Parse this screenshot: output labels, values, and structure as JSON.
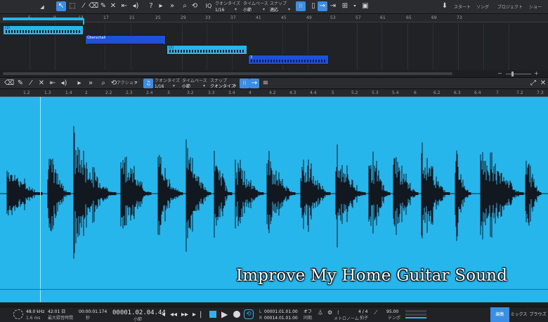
{
  "toolbar": {
    "quantize_label": "クオンタイズ",
    "quantize_value": "1/16",
    "timebase_label": "タイムベース",
    "timebase_value": "小節",
    "snap_label": "スナップ",
    "snap_value": "適応",
    "start_label": "スタート",
    "song_label": "ソング",
    "project_label": "プロジェクト",
    "show_label": "ショー"
  },
  "arrangement": {
    "ruler_labels": [
      "5",
      "9",
      "13",
      "17",
      "21",
      "25",
      "29",
      "33",
      "37",
      "41",
      "45",
      "49",
      "53",
      "57",
      "61",
      "65",
      "69",
      "73"
    ],
    "clips": [
      {
        "label": "(2)",
        "color": "#27b6ec"
      },
      {
        "label": "Überschall",
        "color": "#1e50d8"
      },
      {
        "label": "(2)",
        "color": "#27b6ec"
      },
      {
        "label": "3",
        "color": "#1e50d8"
      }
    ]
  },
  "editor": {
    "action_label": "アクション",
    "quantize_label": "クオンタイズ",
    "quantize_value": "1/16",
    "timebase_label": "タイムベース",
    "timebase_value": "小節",
    "snap_label": "スナップ",
    "snap_value": "クオンタイズ",
    "ruler_labels": [
      "1.2",
      "1.3",
      "1.4",
      "2",
      "2.2",
      "2.3",
      "2.4",
      "3",
      "3.2",
      "3.3",
      "3.4",
      "4",
      "4.2",
      "4.3",
      "4.4",
      "5",
      "5.2",
      "5.3",
      "5.4",
      "6",
      "6.2",
      "6.3",
      "6.4",
      "7",
      "7.2",
      "7.3"
    ]
  },
  "overlay_title": "Improve My Home Guitar Sound",
  "transport": {
    "sample_rate": "48.0 kHz",
    "latency": "1.6 ms",
    "record_time": "42:01 日",
    "record_caption": "最大録音時間",
    "seconds": "00:00:01.174",
    "seconds_caption": "秒",
    "position": "00001.02.04.44",
    "position_caption": "小節",
    "loop_start": "00001.01.01.00",
    "loop_end": "00014.01.01.00",
    "metronome_state": "オフ",
    "metronome_caption": "同期",
    "metronome_label": "メトロノーム",
    "time_signature": "4 / 4",
    "time_signature_caption": "拍子",
    "tempo": "95.00",
    "tempo_caption": "テンポ",
    "tabs": [
      "編集",
      "ミックス",
      "ブラウズ"
    ]
  }
}
